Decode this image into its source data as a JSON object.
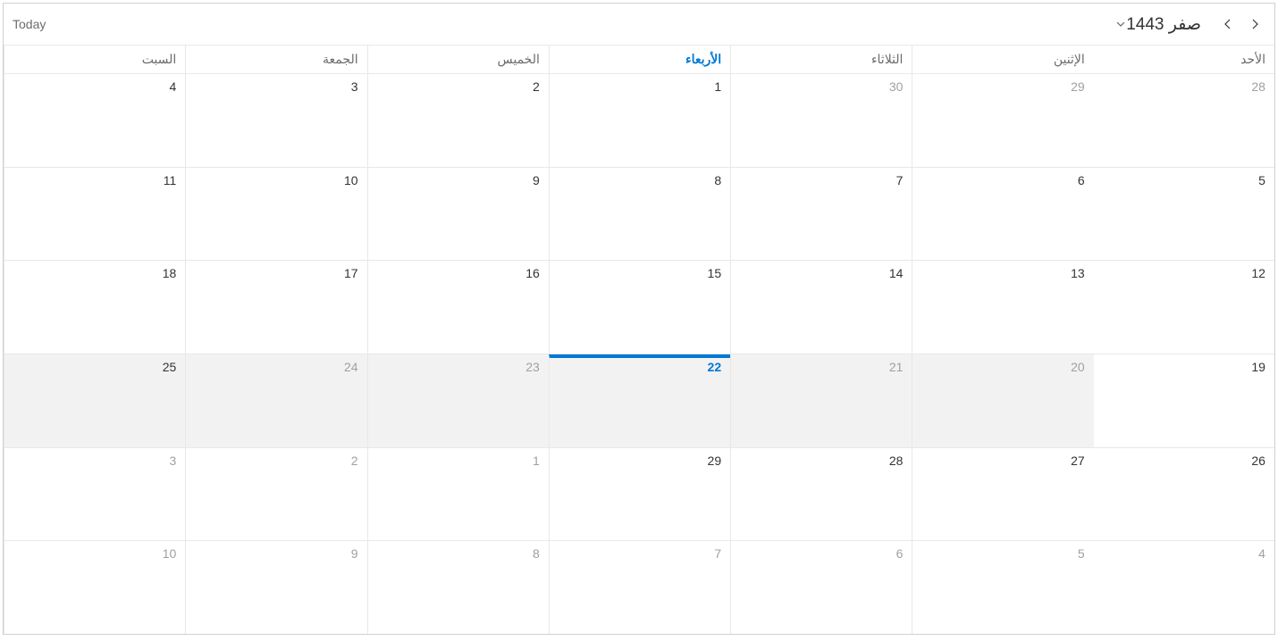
{
  "header": {
    "today_label": "Today",
    "month_title": "صفر 1443"
  },
  "day_headers": [
    {
      "label": "السبت",
      "today": false
    },
    {
      "label": "الجمعة",
      "today": false
    },
    {
      "label": "الخميس",
      "today": false
    },
    {
      "label": "الأربعاء",
      "today": true
    },
    {
      "label": "الثلاثاء",
      "today": false
    },
    {
      "label": "الإثنين",
      "today": false
    },
    {
      "label": "الأحد",
      "today": false
    }
  ],
  "weeks": [
    [
      {
        "n": "4",
        "other": false,
        "today": false,
        "shaded": false,
        "todayBorder": false
      },
      {
        "n": "3",
        "other": false,
        "today": false,
        "shaded": false,
        "todayBorder": false
      },
      {
        "n": "2",
        "other": false,
        "today": false,
        "shaded": false,
        "todayBorder": false
      },
      {
        "n": "1",
        "other": false,
        "today": false,
        "shaded": false,
        "todayBorder": false
      },
      {
        "n": "30",
        "other": true,
        "today": false,
        "shaded": false,
        "todayBorder": false
      },
      {
        "n": "29",
        "other": true,
        "today": false,
        "shaded": false,
        "todayBorder": false
      },
      {
        "n": "28",
        "other": true,
        "today": false,
        "shaded": false,
        "todayBorder": false
      }
    ],
    [
      {
        "n": "11",
        "other": false,
        "today": false,
        "shaded": false,
        "todayBorder": false
      },
      {
        "n": "10",
        "other": false,
        "today": false,
        "shaded": false,
        "todayBorder": false
      },
      {
        "n": "9",
        "other": false,
        "today": false,
        "shaded": false,
        "todayBorder": false
      },
      {
        "n": "8",
        "other": false,
        "today": false,
        "shaded": false,
        "todayBorder": false
      },
      {
        "n": "7",
        "other": false,
        "today": false,
        "shaded": false,
        "todayBorder": false
      },
      {
        "n": "6",
        "other": false,
        "today": false,
        "shaded": false,
        "todayBorder": false
      },
      {
        "n": "5",
        "other": false,
        "today": false,
        "shaded": false,
        "todayBorder": false
      }
    ],
    [
      {
        "n": "18",
        "other": false,
        "today": false,
        "shaded": false,
        "todayBorder": false
      },
      {
        "n": "17",
        "other": false,
        "today": false,
        "shaded": false,
        "todayBorder": false
      },
      {
        "n": "16",
        "other": false,
        "today": false,
        "shaded": false,
        "todayBorder": false
      },
      {
        "n": "15",
        "other": false,
        "today": false,
        "shaded": false,
        "todayBorder": false
      },
      {
        "n": "14",
        "other": false,
        "today": false,
        "shaded": false,
        "todayBorder": false
      },
      {
        "n": "13",
        "other": false,
        "today": false,
        "shaded": false,
        "todayBorder": false
      },
      {
        "n": "12",
        "other": false,
        "today": false,
        "shaded": false,
        "todayBorder": false
      }
    ],
    [
      {
        "n": "25",
        "other": false,
        "today": false,
        "shaded": true,
        "todayBorder": false
      },
      {
        "n": "24",
        "other": true,
        "today": false,
        "shaded": true,
        "todayBorder": false
      },
      {
        "n": "23",
        "other": true,
        "today": false,
        "shaded": true,
        "todayBorder": false
      },
      {
        "n": "22",
        "other": false,
        "today": true,
        "shaded": true,
        "todayBorder": true
      },
      {
        "n": "21",
        "other": true,
        "today": false,
        "shaded": true,
        "todayBorder": false
      },
      {
        "n": "20",
        "other": true,
        "today": false,
        "shaded": true,
        "todayBorder": false
      },
      {
        "n": "19",
        "other": false,
        "today": false,
        "shaded": false,
        "todayBorder": false
      }
    ],
    [
      {
        "n": "3",
        "other": true,
        "today": false,
        "shaded": false,
        "todayBorder": false
      },
      {
        "n": "2",
        "other": true,
        "today": false,
        "shaded": false,
        "todayBorder": false
      },
      {
        "n": "1",
        "other": true,
        "today": false,
        "shaded": false,
        "todayBorder": false
      },
      {
        "n": "29",
        "other": false,
        "today": false,
        "shaded": false,
        "todayBorder": false
      },
      {
        "n": "28",
        "other": false,
        "today": false,
        "shaded": false,
        "todayBorder": false
      },
      {
        "n": "27",
        "other": false,
        "today": false,
        "shaded": false,
        "todayBorder": false
      },
      {
        "n": "26",
        "other": false,
        "today": false,
        "shaded": false,
        "todayBorder": false
      }
    ],
    [
      {
        "n": "10",
        "other": true,
        "today": false,
        "shaded": false,
        "todayBorder": false
      },
      {
        "n": "9",
        "other": true,
        "today": false,
        "shaded": false,
        "todayBorder": false
      },
      {
        "n": "8",
        "other": true,
        "today": false,
        "shaded": false,
        "todayBorder": false
      },
      {
        "n": "7",
        "other": true,
        "today": false,
        "shaded": false,
        "todayBorder": false
      },
      {
        "n": "6",
        "other": true,
        "today": false,
        "shaded": false,
        "todayBorder": false
      },
      {
        "n": "5",
        "other": true,
        "today": false,
        "shaded": false,
        "todayBorder": false
      },
      {
        "n": "4",
        "other": true,
        "today": false,
        "shaded": false,
        "todayBorder": false
      }
    ]
  ]
}
